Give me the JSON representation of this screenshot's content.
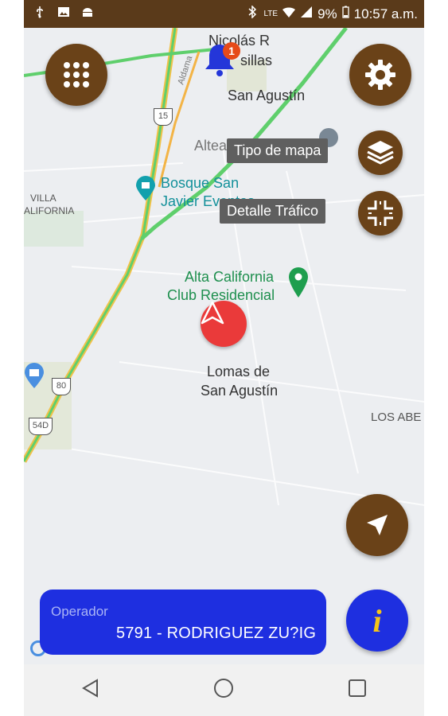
{
  "status_bar": {
    "battery": "9%",
    "time": "10:57 a.m.",
    "network": "LTE",
    "left_icons": [
      "usb-icon",
      "image-icon",
      "android-icon"
    ]
  },
  "map": {
    "labels": {
      "nicolas": "Nicolás R",
      "casillas": "sillas",
      "san_agustin": "San Agustín",
      "altea": "Altea Residencial",
      "bosque_1": "Bosque San",
      "bosque_2": "Javier Eventos",
      "villa_1": "VILLA",
      "villa_2": "ALIFORNIA",
      "alta_1": "Alta California",
      "alta_2": "Club Residencial",
      "lomas_1": "Lomas de",
      "lomas_2": "San Agustín",
      "los_abe": "LOS ABE",
      "road_aldama": "Aldama",
      "shield_15": "15",
      "shield_80": "80",
      "shield_54d": "54D"
    },
    "notification_count": "1"
  },
  "tooltips": {
    "map_type": "Tipo de mapa",
    "traffic": "Detalle Tráfico"
  },
  "operator": {
    "label": "Operador",
    "value": "5791 - RODRIGUEZ ZU?IG"
  },
  "info_button": "i",
  "colors": {
    "status_bar": "#5a3a1a",
    "fab_brown": "#6a4218",
    "operator_blue": "#1e2fe0",
    "info_yellow": "#f5c518",
    "location_red": "#ea3a3a"
  }
}
